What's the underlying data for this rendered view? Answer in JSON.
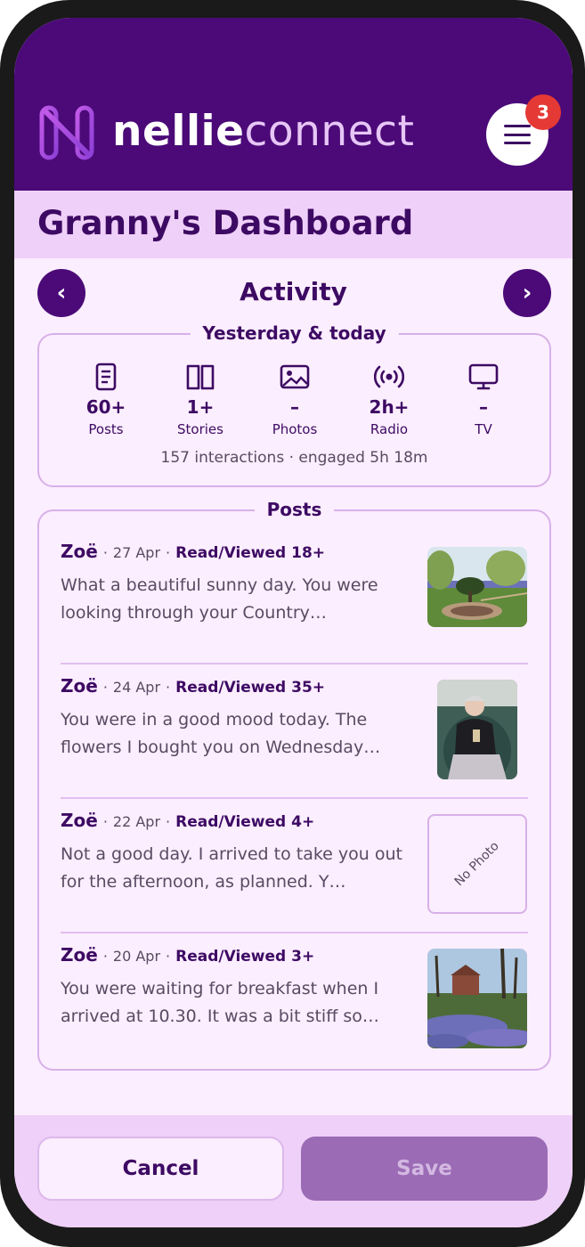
{
  "header": {
    "brand_bold": "nellie",
    "brand_light": "connect",
    "notification_count": "3"
  },
  "page": {
    "title": "Granny's Dashboard"
  },
  "activity": {
    "title": "Activity",
    "prev_label": "‹",
    "next_label": "›",
    "period_label": "Yesterday & today",
    "stats": [
      {
        "icon": "document-icon",
        "value": "60+",
        "label": "Posts"
      },
      {
        "icon": "book-icon",
        "value": "1+",
        "label": "Stories"
      },
      {
        "icon": "image-icon",
        "value": "–",
        "label": "Photos"
      },
      {
        "icon": "radio-icon",
        "value": "2h+",
        "label": "Radio"
      },
      {
        "icon": "tv-icon",
        "value": "–",
        "label": "TV"
      }
    ],
    "summary": "157 interactions · engaged 5h 18m"
  },
  "posts": {
    "title": "Posts",
    "items": [
      {
        "author": "Zoë",
        "date": "27 Apr",
        "reads": "Read/Viewed 18+",
        "text": "What a beautiful sunny day.  You were looking through your Country…",
        "thumb": "garden-photo"
      },
      {
        "author": "Zoë",
        "date": "24 Apr",
        "reads": "Read/Viewed 35+",
        "text": "You were in a good mood today. The flowers I bought you on Wednesday…",
        "thumb": "portrait-photo"
      },
      {
        "author": "Zoë",
        "date": "22 Apr",
        "reads": "Read/Viewed 4+",
        "text": "Not a good day. I arrived to take you out for the afternoon, as planned. Y…",
        "thumb": "none",
        "no_photo_label": "No Photo"
      },
      {
        "author": "Zoë",
        "date": "20 Apr",
        "reads": "Read/Viewed 3+",
        "text": "You were waiting for breakfast when I arrived at 10.30. It was a bit stiff so…",
        "thumb": "bluebell-photo"
      }
    ]
  },
  "footer": {
    "cancel_label": "Cancel",
    "save_label": "Save"
  },
  "colors": {
    "primary": "#4b0a78",
    "background": "#fbeefe",
    "accent": "#efd0f8",
    "badge": "#e53935"
  }
}
